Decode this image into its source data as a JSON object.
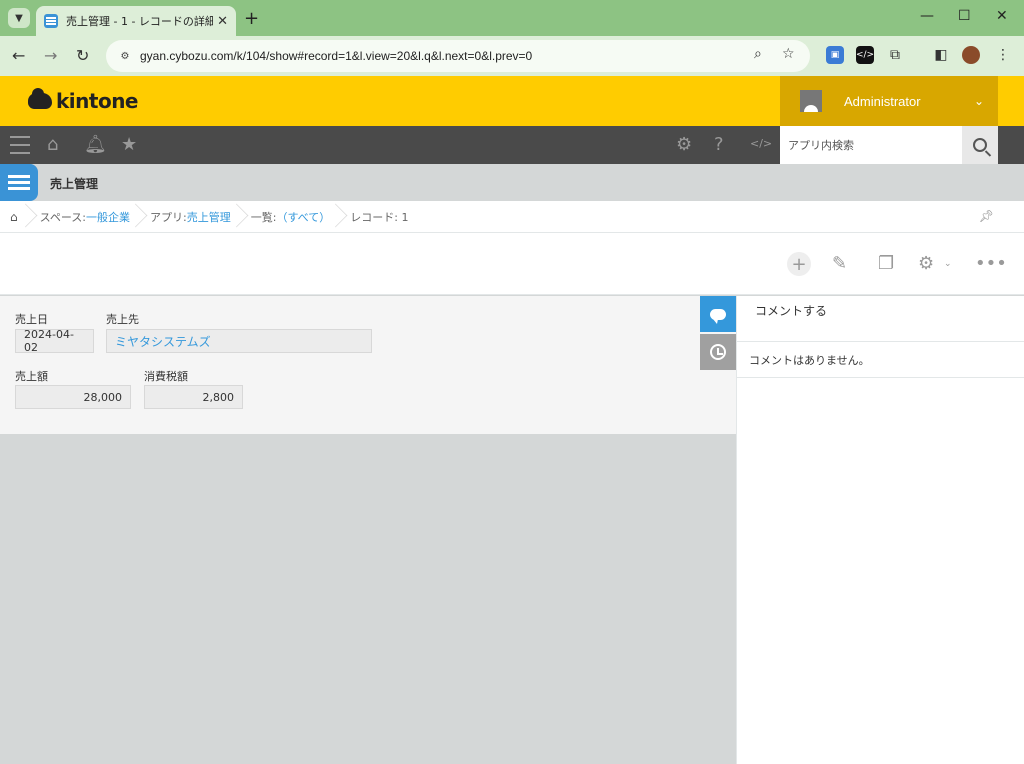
{
  "browser": {
    "tab_title": "売上管理 - 1 - レコードの詳細",
    "tab_close": "✕",
    "new_tab": "+",
    "url": "gyan.cybozu.com/k/104/show#record=1&l.view=20&l.q&l.next=0&l.prev=0",
    "window_controls": {
      "minimize": "—",
      "maximize": "☐",
      "close": "✕"
    }
  },
  "header": {
    "logo_text": "kintone",
    "user_name": "Administrator",
    "search_placeholder": "アプリ内検索"
  },
  "app": {
    "title": "売上管理"
  },
  "breadcrumb": [
    {
      "prefix": "スペース: ",
      "link": "一般企業"
    },
    {
      "prefix": "アプリ: ",
      "link": "売上管理"
    },
    {
      "prefix": "一覧: ",
      "link": "（すべて）"
    },
    {
      "prefix": "レコード: 1",
      "link": ""
    }
  ],
  "record": {
    "fields": {
      "sales_date": {
        "label": "売上日",
        "value": "2024-04-02"
      },
      "customer": {
        "label": "売上先",
        "value": "ミヤタシステムズ"
      },
      "amount": {
        "label": "売上額",
        "value": "28,000"
      },
      "tax": {
        "label": "消費税額",
        "value": "2,800"
      }
    }
  },
  "comments": {
    "input_label": "コメントする",
    "empty_message": "コメントはありません。"
  },
  "icons": {
    "accent": "#fc0",
    "link_color": "#3498db"
  }
}
